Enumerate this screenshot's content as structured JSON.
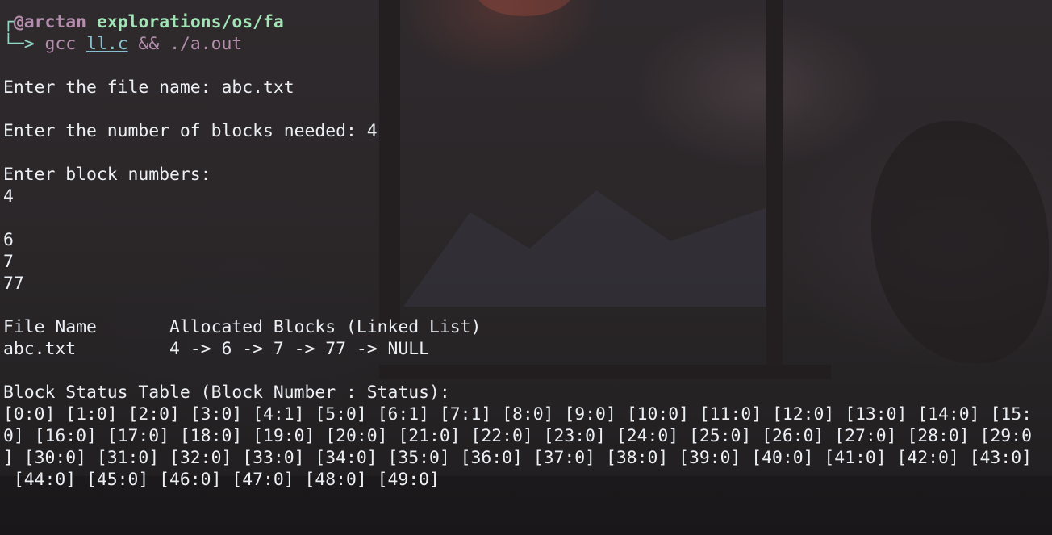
{
  "prompt": {
    "user": "@arctan",
    "cwd": "explorations/os/fa",
    "arrow": "└─>",
    "command": "gcc",
    "file": "ll.c",
    "operator": "&&",
    "exec": "./a.out"
  },
  "output": {
    "file_name_prompt": "Enter the file name: abc.txt",
    "blocks_needed_prompt": "Enter the number of blocks needed: 4",
    "block_numbers_prompt": "Enter block numbers:",
    "block_inputs": [
      "4",
      "",
      "6",
      "7",
      "77"
    ],
    "table_header": "File Name       Allocated Blocks (Linked List)",
    "table_row": "abc.txt         4 -> 6 -> 7 -> 77 -> NULL",
    "status_title": "Block Status Table (Block Number : Status):",
    "status_lines": [
      "[0:0] [1:0] [2:0] [3:0] [4:1] [5:0] [6:1] [7:1] [8:0] [9:0] [10:0] [11:0] [12:0] [13:0] [14:0] [15:",
      "0] [16:0] [17:0] [18:0] [19:0] [20:0] [21:0] [22:0] [23:0] [24:0] [25:0] [26:0] [27:0] [28:0] [29:0",
      "] [30:0] [31:0] [32:0] [33:0] [34:0] [35:0] [36:0] [37:0] [38:0] [39:0] [40:0] [41:0] [42:0] [43:0]",
      " [44:0] [45:0] [46:0] [47:0] [48:0] [49:0]"
    ]
  },
  "colors": {
    "user": "#b48ead",
    "cwd": "#a3e4b7",
    "arrow": "#8fd9c8",
    "file": "#88c0d0",
    "text": "#eceff4"
  }
}
